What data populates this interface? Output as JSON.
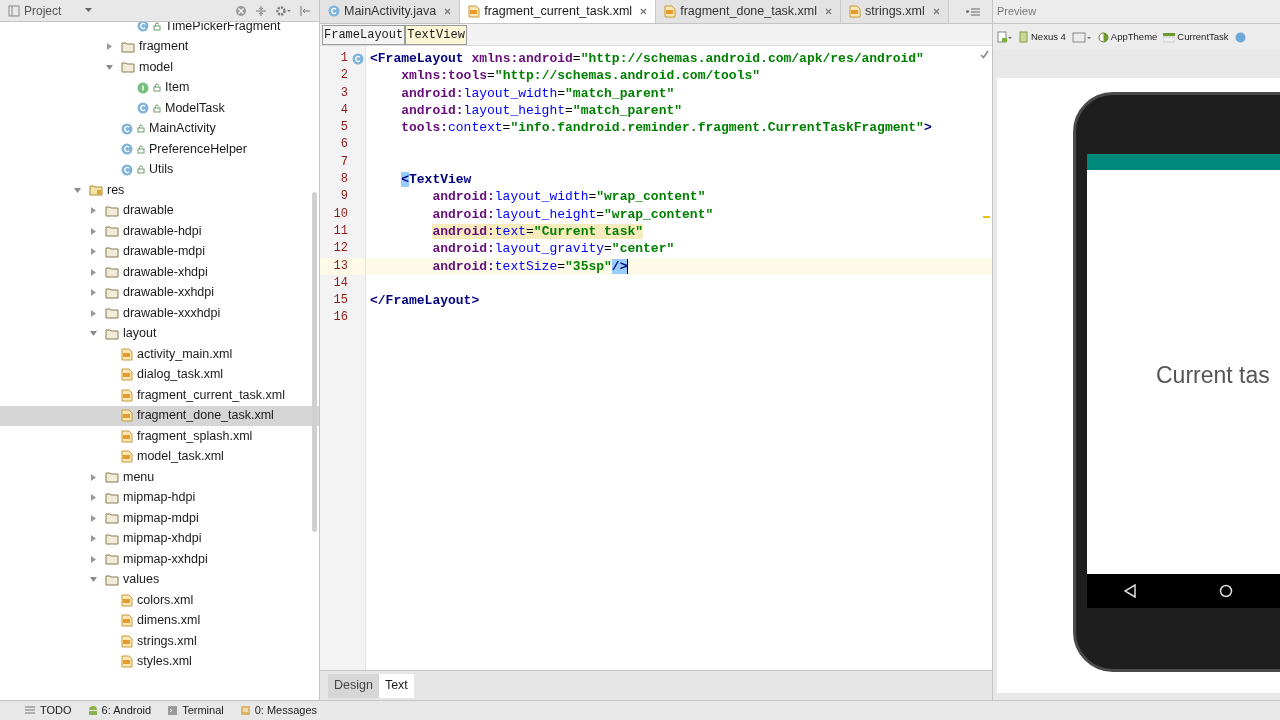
{
  "project_panel": {
    "title": "Project",
    "tree": [
      {
        "label": "TimePickerFragment",
        "kind": "class"
      },
      {
        "label": "fragment",
        "kind": "folder",
        "expanded": false
      },
      {
        "label": "model",
        "kind": "folder",
        "expanded": true,
        "children": [
          {
            "label": "Item",
            "kind": "interface"
          },
          {
            "label": "ModelTask",
            "kind": "class"
          }
        ]
      },
      {
        "label": "MainActivity",
        "kind": "class"
      },
      {
        "label": "PreferenceHelper",
        "kind": "class"
      },
      {
        "label": "Utils",
        "kind": "class"
      }
    ],
    "res": {
      "label": "res",
      "kind": "res",
      "expanded": true,
      "children": [
        {
          "label": "drawable",
          "kind": "folder",
          "expanded": false
        },
        {
          "label": "drawable-hdpi",
          "kind": "folder",
          "expanded": false
        },
        {
          "label": "drawable-mdpi",
          "kind": "folder",
          "expanded": false
        },
        {
          "label": "drawable-xhdpi",
          "kind": "folder",
          "expanded": false
        },
        {
          "label": "drawable-xxhdpi",
          "kind": "folder",
          "expanded": false
        },
        {
          "label": "drawable-xxxhdpi",
          "kind": "folder",
          "expanded": false
        },
        {
          "label": "layout",
          "kind": "folder",
          "expanded": true,
          "children": [
            {
              "label": "activity_main.xml",
              "kind": "xml",
              "selected": false
            },
            {
              "label": "dialog_task.xml",
              "kind": "xml",
              "selected": false
            },
            {
              "label": "fragment_current_task.xml",
              "kind": "xml",
              "selected": false
            },
            {
              "label": "fragment_done_task.xml",
              "kind": "xml",
              "selected": true
            },
            {
              "label": "fragment_splash.xml",
              "kind": "xml",
              "selected": false
            },
            {
              "label": "model_task.xml",
              "kind": "xml",
              "selected": false
            }
          ]
        },
        {
          "label": "menu",
          "kind": "folder",
          "expanded": false
        },
        {
          "label": "mipmap-hdpi",
          "kind": "folder",
          "expanded": false
        },
        {
          "label": "mipmap-mdpi",
          "kind": "folder",
          "expanded": false
        },
        {
          "label": "mipmap-xhdpi",
          "kind": "folder",
          "expanded": false
        },
        {
          "label": "mipmap-xxhdpi",
          "kind": "folder",
          "expanded": false
        },
        {
          "label": "values",
          "kind": "folder",
          "expanded": true,
          "children": [
            {
              "label": "colors.xml",
              "kind": "xml",
              "selected": false
            },
            {
              "label": "dimens.xml",
              "kind": "xml",
              "selected": false
            },
            {
              "label": "strings.xml",
              "kind": "xml",
              "selected": false
            },
            {
              "label": "styles.xml",
              "kind": "xml",
              "selected": false
            }
          ]
        }
      ]
    }
  },
  "editor_tabs": [
    {
      "label": "MainActivity.java",
      "kind": "class",
      "selected": false
    },
    {
      "label": "fragment_current_task.xml",
      "kind": "xml",
      "selected": true
    },
    {
      "label": "fragment_done_task.xml",
      "kind": "xml",
      "selected": false
    },
    {
      "label": "strings.xml",
      "kind": "xml",
      "selected": false
    }
  ],
  "breadcrumbs": [
    {
      "label": "FrameLayout",
      "selected": false
    },
    {
      "label": "TextView",
      "selected": true
    }
  ],
  "code": [
    {
      "number": "1",
      "kind": "root",
      "tokens": [
        {
          "kind": "tag",
          "text": "<FrameLayout "
        },
        {
          "kind": "ns",
          "text": "xmlns:android"
        },
        {
          "kind": "punct",
          "text": "="
        },
        {
          "kind": "str",
          "text": "\"http://schemas.android.com/apk/res/android\""
        }
      ]
    },
    {
      "number": "2",
      "kind": "root_attr",
      "tokens": [
        {
          "kind": "ns",
          "text": "xmlns:tools"
        },
        {
          "kind": "punct",
          "text": "="
        },
        {
          "kind": "str",
          "text": "\"http://schemas.android.com/tools\""
        }
      ]
    },
    {
      "number": "3",
      "kind": "root_attr",
      "tokens": [
        {
          "kind": "ns",
          "text": "android:"
        },
        {
          "kind": "attr",
          "text": "layout_width"
        },
        {
          "kind": "punct",
          "text": "="
        },
        {
          "kind": "str",
          "text": "\"match_parent\""
        }
      ]
    },
    {
      "number": "4",
      "kind": "root_attr",
      "tokens": [
        {
          "kind": "ns",
          "text": "android:"
        },
        {
          "kind": "attr",
          "text": "layout_height"
        },
        {
          "kind": "punct",
          "text": "="
        },
        {
          "kind": "str",
          "text": "\"match_parent\""
        }
      ]
    },
    {
      "number": "5",
      "kind": "root_attr",
      "tokens": [
        {
          "kind": "ns",
          "text": "tools:"
        },
        {
          "kind": "attr",
          "text": "context"
        },
        {
          "kind": "punct",
          "text": "="
        },
        {
          "kind": "str",
          "text": "\"info.fandroid.reminder.fragment.CurrentTaskFragment\""
        },
        {
          "kind": "tag",
          "text": ">"
        }
      ]
    },
    {
      "number": "6",
      "kind": "blank"
    },
    {
      "number": "7",
      "kind": "blank"
    },
    {
      "number": "8",
      "kind": "child",
      "tokens": [
        {
          "kind": "match",
          "text": "<"
        },
        {
          "kind": "tag",
          "text": "TextView"
        }
      ]
    },
    {
      "number": "9",
      "kind": "child_attr",
      "tokens": [
        {
          "kind": "ns",
          "text": "android:"
        },
        {
          "kind": "attr",
          "text": "layout_width"
        },
        {
          "kind": "punct",
          "text": "="
        },
        {
          "kind": "str",
          "text": "\"wrap_content\""
        }
      ]
    },
    {
      "number": "10",
      "kind": "child_attr",
      "tokens": [
        {
          "kind": "ns",
          "text": "android:"
        },
        {
          "kind": "attr",
          "text": "layout_height"
        },
        {
          "kind": "punct",
          "text": "="
        },
        {
          "kind": "str",
          "text": "\"wrap_content\""
        }
      ]
    },
    {
      "number": "11",
      "kind": "child_attr",
      "highlighted": true,
      "tokens": [
        {
          "kind": "ns",
          "text": "android:"
        },
        {
          "kind": "attr",
          "text": "text"
        },
        {
          "kind": "punct",
          "text": "="
        },
        {
          "kind": "str",
          "text": "\"Current task\""
        }
      ]
    },
    {
      "number": "12",
      "kind": "child_attr",
      "tokens": [
        {
          "kind": "ns",
          "text": "android:"
        },
        {
          "kind": "attr",
          "text": "layout_gravity"
        },
        {
          "kind": "punct",
          "text": "="
        },
        {
          "kind": "str",
          "text": "\"center\""
        }
      ]
    },
    {
      "number": "13",
      "kind": "child_attr",
      "current": true,
      "tokens": [
        {
          "kind": "ns",
          "text": "android:"
        },
        {
          "kind": "attr",
          "text": "textSize"
        },
        {
          "kind": "punct",
          "text": "="
        },
        {
          "kind": "str",
          "text": "\"35sp\""
        },
        {
          "kind": "match",
          "text": "/>"
        }
      ]
    },
    {
      "number": "14",
      "kind": "blank"
    },
    {
      "number": "15",
      "kind": "root",
      "tokens": [
        {
          "kind": "tag",
          "text": "</FrameLayout>"
        }
      ]
    },
    {
      "number": "16",
      "kind": "blank"
    }
  ],
  "view_tabs": [
    {
      "label": "Design",
      "selected": false
    },
    {
      "label": "Text",
      "selected": true
    }
  ],
  "preview": {
    "title": "Preview",
    "device": "Nexus 4",
    "theme": "AppTheme",
    "activity": "CurrentTask",
    "screen_text": "Current tas"
  },
  "tool_windows": [
    {
      "label": "TODO",
      "kind": "todo"
    },
    {
      "label": "6: Android",
      "kind": "android"
    },
    {
      "label": "Terminal",
      "kind": "terminal"
    },
    {
      "label": "0: Messages",
      "kind": "messages"
    }
  ]
}
